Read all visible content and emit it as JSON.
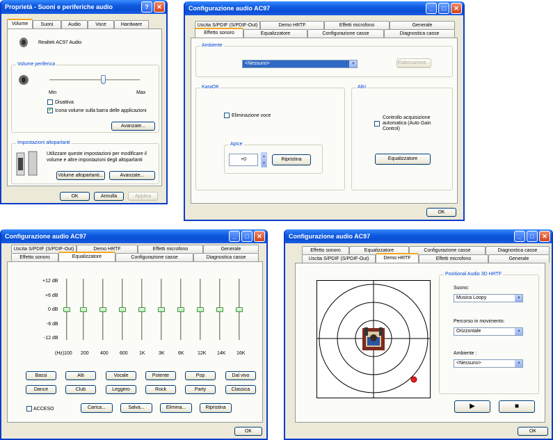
{
  "w1": {
    "title": "Proprietà - Suoni e periferiche audio",
    "help": "?",
    "close": "✕",
    "tabs": [
      "Volume",
      "Suoni",
      "Audio",
      "Voce",
      "Hardware"
    ],
    "device": "Realtek AC97 Audio",
    "vol_group": "Volume periferica",
    "min": "Min",
    "max": "Max",
    "volume_level": 0.6,
    "mute": "Disattiva",
    "show_icon": "Icona volume sulla barra delle applicazioni",
    "show_icon_checked": "✔",
    "advanced": "Avanzate...",
    "spk_group": "Impostazioni altoparlanti",
    "spk_text": [
      "Utilizzare queste impostazioni per modificare il",
      "volume e altre impostazioni degli altoparlanti"
    ],
    "spk_volume": "Volume altoparlanti...",
    "spk_advanced": "Avanzate...",
    "ok": "OK",
    "cancel": "Annulla",
    "apply": "Applica"
  },
  "w2": {
    "title": "Configurazione audio AC97",
    "tabs_top": [
      "Uscita S/PDIF (S/PDIF-Out)",
      "Demo HRTF",
      "Effetti microfono",
      "Generale"
    ],
    "tabs_bottom": [
      "Effetto sonoro",
      "Equalizzatore",
      "Configurazione casse",
      "Diagnostica casse"
    ],
    "env_group": "Ambiente",
    "env_value": "<Nessuno>",
    "edit": "Elaborazione...",
    "karaok_group": "KaraOK",
    "voice_cancel": "Eliminazione voce",
    "pitch_label": "Apice",
    "pitch_value": "+0",
    "reset": "Ripristina",
    "other_group": "Altri",
    "agc": [
      "Controllo acquisizione",
      "automatica (Auto Gain",
      "Control)"
    ],
    "equalizer": "Equalizzatore",
    "ok": "OK"
  },
  "w3": {
    "title": "Configurazione audio AC97",
    "tabs_top": [
      "Uscita S/PDIF (S/PDIF-Out)",
      "Demo HRTF",
      "Effetti microfono",
      "Generale"
    ],
    "tabs_bottom": [
      "Effetto sonoro",
      "Equalizzatore",
      "Configurazione casse",
      "Diagnostica casse"
    ],
    "db_labels": [
      "+12 dB",
      "+6 dB",
      "0 dB",
      "-6 dB",
      "-12 dB"
    ],
    "hz_label": "(Hz)",
    "freqs": [
      "100",
      "200",
      "400",
      "600",
      "1K",
      "3K",
      "6K",
      "12K",
      "14K",
      "16K"
    ],
    "presets_row1": [
      "Bassi",
      "Alti",
      "Vocale",
      "Potente",
      "Pop",
      "Dal vivo"
    ],
    "presets_row2": [
      "Dance",
      "Club",
      "Leggero",
      "Rock",
      "Party",
      "Classica"
    ],
    "on_label": "ACCESO",
    "load": "Carica...",
    "save": "Salva...",
    "delete": "Elimina...",
    "restore": "Ripristina",
    "ok": "OK"
  },
  "w4": {
    "title": "Configurazione audio AC97",
    "tabs_top": [
      "Effetto sonoro",
      "Equalizzatore",
      "Configurazione casse",
      "Diagnostica casse"
    ],
    "tabs_bottom": [
      "Uscita S/PDIF (S/PDIF-Out)",
      "Demo HRTF",
      "Effetti microfono",
      "Generale"
    ],
    "group": "Positional Audio 3D HRTF",
    "sound_label": "Suono:",
    "sound_value": "Musica Loopy",
    "path_label": "Percorso in movimento:",
    "path_value": "Orizzontale",
    "env_label": "Ambiente :",
    "env_value": "<Nessuno>",
    "play": "▶",
    "stop": "■",
    "ok": "OK"
  }
}
